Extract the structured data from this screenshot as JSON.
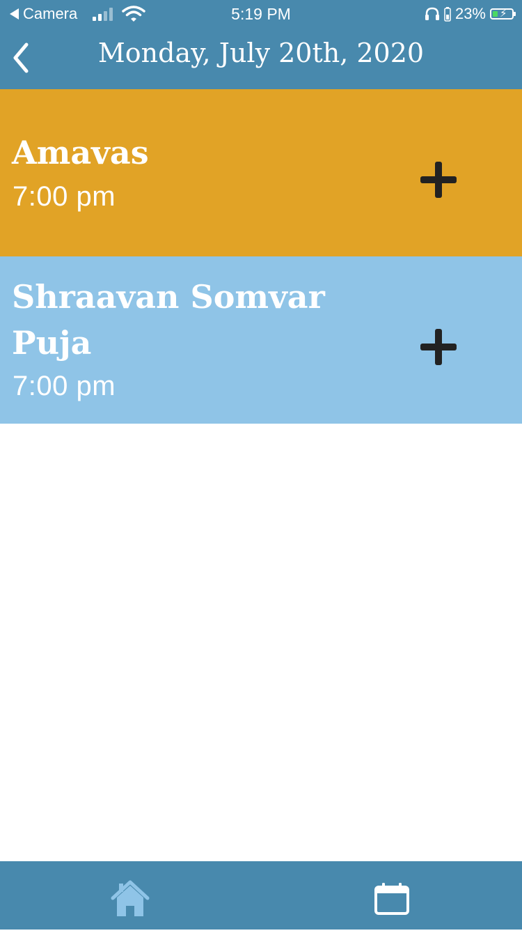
{
  "colors": {
    "header_bg": "#4889ad",
    "accent_blue": "#8fc4e7",
    "gold": "#e1a326",
    "dark": "#222222"
  },
  "status_bar": {
    "back_app": "Camera",
    "time": "5:19 PM",
    "battery": "23%",
    "icons": [
      "back-triangle-icon",
      "signal-icon",
      "wifi-icon",
      "headphones-icon",
      "battery-icon"
    ]
  },
  "header": {
    "title": "Monday, July 20th, 2020",
    "back_icon": "chevron-left-icon"
  },
  "events": [
    {
      "name": "Amavas",
      "time": "7:00 pm",
      "color": "#e1a326",
      "action_icon": "plus-icon"
    },
    {
      "name": "Shraavan Somvar Puja",
      "time": "7:00 pm",
      "color": "#8fc4e7",
      "action_icon": "plus-icon"
    }
  ],
  "tabbar": {
    "items": [
      {
        "icon": "home-icon"
      },
      {
        "icon": "calendar-icon"
      }
    ]
  }
}
